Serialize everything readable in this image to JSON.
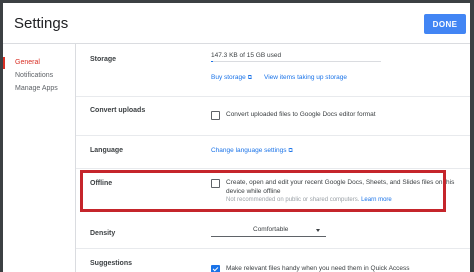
{
  "dialog": {
    "title": "Settings",
    "done_label": "DONE"
  },
  "nav": {
    "items": [
      "General",
      "Notifications",
      "Manage Apps"
    ]
  },
  "storage": {
    "label": "Storage",
    "usage_text": "147.3 KB of 15 GB used",
    "usage_fraction": 0.01,
    "buy_label": "Buy storage",
    "view_label": "View items taking up storage"
  },
  "convert": {
    "label": "Convert uploads",
    "checkbox_text": "Convert uploaded files to Google Docs editor format",
    "checked": false
  },
  "language": {
    "label": "Language",
    "link_text": "Change language settings"
  },
  "offline": {
    "label": "Offline",
    "line1": "Create, open and edit your recent Google Docs, Sheets, and Slides files on this",
    "line2": "device while offline",
    "note": "Not recommended on public or shared computers.",
    "learn_more": "Learn more",
    "checked": false
  },
  "density": {
    "label": "Density",
    "value": "Comfortable"
  },
  "suggestions": {
    "label": "Suggestions",
    "checkbox_text": "Make relevant files handy when you need them in Quick Access",
    "checked": true
  },
  "colors": {
    "accent": "#4285f4",
    "highlight": "#c5252b",
    "nav_active": "#d93025"
  }
}
